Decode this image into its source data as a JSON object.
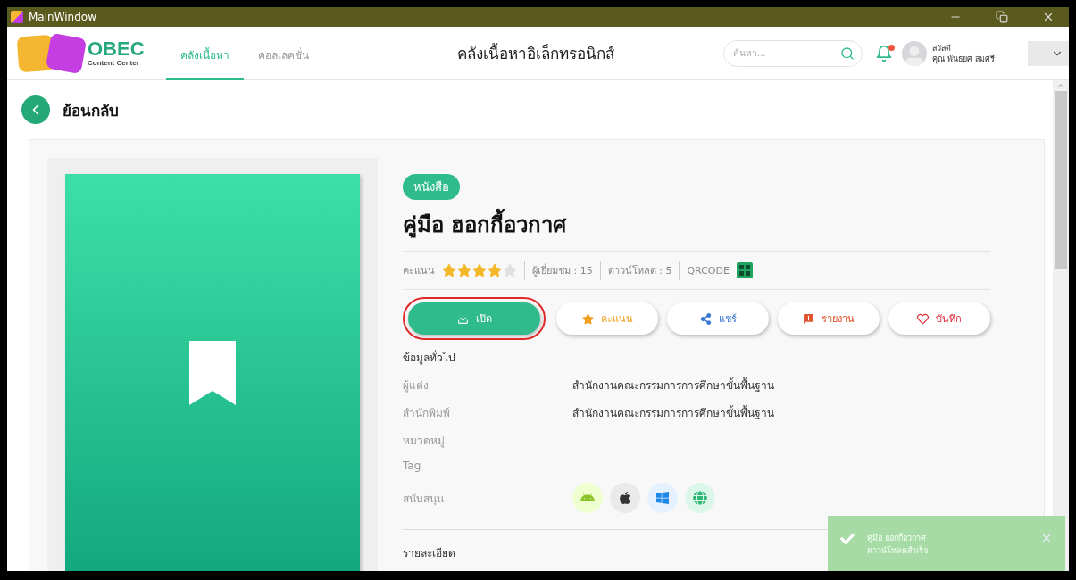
{
  "window": {
    "title": "MainWindow"
  },
  "header": {
    "logo": {
      "title": "OBEC",
      "subtitle": "Content Center"
    },
    "tabs": [
      {
        "label": "คลังเนื้อหา",
        "selected": true
      },
      {
        "label": "คอลเลคชั่น",
        "selected": false
      }
    ],
    "page_title": "คลังเนื้อหาอิเล็กทรอนิกส์",
    "search": {
      "placeholder": "ค้นหา..."
    },
    "notification": {
      "unread": true
    },
    "user": {
      "greeting": "สวัสดี",
      "name": "คุณ พันธยศ สมศรี"
    }
  },
  "back": {
    "label": "ย้อนกลับ"
  },
  "item": {
    "type_badge": "หนังสือ",
    "title": "คู่มือ ฮอกกี้อวกาศ",
    "rating_label": "คะแนน",
    "stars": 4,
    "views": "ผู้เยี่ยมชม :  15",
    "downloads": "ดาวน์โหลด :  5",
    "qrcode": "QRCODE",
    "actions": [
      {
        "kind": "open",
        "label": "เปิด",
        "highlighted": true
      },
      {
        "kind": "rate",
        "label": "คะแนน",
        "highlighted": false
      },
      {
        "kind": "share",
        "label": "แชร์",
        "highlighted": false
      },
      {
        "kind": "report",
        "label": "รายงาน",
        "highlighted": false
      },
      {
        "kind": "save",
        "label": "บันทึก",
        "highlighted": false
      }
    ],
    "info_heading": "ข้อมูลทั่วไป",
    "info": [
      {
        "label": "ผู้แต่ง",
        "value": "สำนักงานคณะกรรมการการศึกษาขั้นพื้นฐาน"
      },
      {
        "label": "สำนักพิมพ์",
        "value": "สำนักงานคณะกรรมการการศึกษาขั้นพื้นฐาน"
      },
      {
        "label": "หมวดหมู่"
      },
      {
        "label": "Tag"
      }
    ],
    "support_label": "สนับสนุน",
    "platforms": [
      {
        "kind": "android"
      },
      {
        "kind": "apple"
      },
      {
        "kind": "windows"
      },
      {
        "kind": "web"
      }
    ],
    "details_heading": "รายละเอียด"
  },
  "toast": {
    "title": "คู่มือ ฮอกกี้อวกาศ",
    "message": "ดาวน์โหลดสำเร็จ"
  }
}
